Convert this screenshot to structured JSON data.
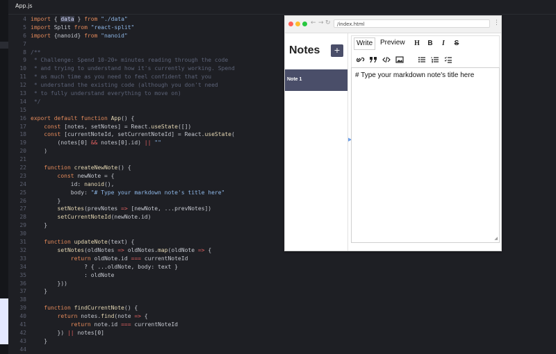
{
  "editor": {
    "file_tab": "App.js",
    "lines": [
      {
        "n": "4",
        "html": "<span class='kw2'>import</span> { <span class='hl'>data</span> } <span class='kw2'>from</span> <span class='str'>\"./data\"</span>"
      },
      {
        "n": "5",
        "html": "<span class='kw2'>import</span> Split <span class='kw2'>from</span> <span class='str'>\"react-split\"</span>"
      },
      {
        "n": "6",
        "html": "<span class='kw2'>import</span> {nanoid} <span class='kw2'>from</span> <span class='str'>\"nanoid\"</span>"
      },
      {
        "n": "7",
        "html": ""
      },
      {
        "n": "8",
        "html": "<span class='cm'>/**</span>"
      },
      {
        "n": "9",
        "html": "<span class='cm'> * Challenge: Spend 10-20+ minutes reading through the code</span>"
      },
      {
        "n": "10",
        "html": "<span class='cm'> * and trying to understand how it's currently working. Spend</span>"
      },
      {
        "n": "11",
        "html": "<span class='cm'> * as much time as you need to feel confident that you</span>"
      },
      {
        "n": "12",
        "html": "<span class='cm'> * understand the existing code (although you don't need</span>"
      },
      {
        "n": "13",
        "html": "<span class='cm'> * to fully understand everything to move on)</span>"
      },
      {
        "n": "14",
        "html": "<span class='cm'> */</span>"
      },
      {
        "n": "15",
        "html": ""
      },
      {
        "n": "16",
        "html": "<span class='kw2'>export default function</span> <span class='fn'>App</span>() {"
      },
      {
        "n": "17",
        "html": "    <span class='kw2'>const</span> [notes, setNotes] = React.<span class='fn'>useState</span>([])"
      },
      {
        "n": "18",
        "html": "    <span class='kw2'>const</span> [currentNoteId, setCurrentNoteId] = React.<span class='fn'>useState</span>("
      },
      {
        "n": "19",
        "html": "        (notes[0] <span class='op'>&amp;&amp;</span> notes[0].id) <span class='op'>||</span> <span class='str'>\"\"</span>"
      },
      {
        "n": "20",
        "html": "    )"
      },
      {
        "n": "21",
        "html": ""
      },
      {
        "n": "22",
        "html": "    <span class='kw2'>function</span> <span class='fn'>createNewNote</span>() {"
      },
      {
        "n": "23",
        "html": "        <span class='kw2'>const</span> newNote = {"
      },
      {
        "n": "24",
        "html": "            id: <span class='fn'>nanoid</span>(),"
      },
      {
        "n": "25",
        "html": "            body: <span class='str'>\"# Type your markdown note's title here\"</span>"
      },
      {
        "n": "26",
        "html": "        }"
      },
      {
        "n": "27",
        "html": "        <span class='fn'>setNotes</span>(prevNotes <span class='op'>=&gt;</span> [newNote, ...prevNotes])"
      },
      {
        "n": "28",
        "html": "        <span class='fn'>setCurrentNoteId</span>(newNote.id)"
      },
      {
        "n": "29",
        "html": "    }"
      },
      {
        "n": "30",
        "html": ""
      },
      {
        "n": "31",
        "html": "    <span class='kw2'>function</span> <span class='fn'>updateNote</span>(text) {"
      },
      {
        "n": "32",
        "html": "        <span class='fn'>setNotes</span>(oldNotes <span class='op'>=&gt;</span> oldNotes.<span class='fn'>map</span>(oldNote <span class='op'>=&gt;</span> {"
      },
      {
        "n": "33",
        "html": "            <span class='kw2'>return</span> oldNote.id <span class='op'>===</span> currentNoteId"
      },
      {
        "n": "34",
        "html": "                ? { ...oldNote, body: text }"
      },
      {
        "n": "35",
        "html": "                : oldNote"
      },
      {
        "n": "36",
        "html": "        }))"
      },
      {
        "n": "37",
        "html": "    }"
      },
      {
        "n": "38",
        "html": ""
      },
      {
        "n": "39",
        "html": "    <span class='kw2'>function</span> <span class='fn'>findCurrentNote</span>() {"
      },
      {
        "n": "40",
        "html": "        <span class='kw2'>return</span> notes.<span class='fn'>find</span>(note <span class='op'>=&gt;</span> {"
      },
      {
        "n": "41",
        "html": "            <span class='kw2'>return</span> note.id <span class='op'>===</span> currentNoteId"
      },
      {
        "n": "42",
        "html": "        }) <span class='op'>||</span> notes[0]"
      },
      {
        "n": "43",
        "html": "    }"
      },
      {
        "n": "44",
        "html": ""
      }
    ]
  },
  "browser": {
    "nav_back": "←",
    "nav_forward": "→",
    "nav_reload": "↻",
    "url": "/index.html",
    "menu": "⋮"
  },
  "app": {
    "sidebar_title": "Notes",
    "add_button": "+",
    "notes": [
      {
        "label": "Note 1"
      }
    ],
    "tabs": {
      "write": "Write",
      "preview": "Preview"
    },
    "toolbar_row1": [
      "H",
      "B",
      "I",
      "S"
    ],
    "toolbar_row2": [
      "link-icon",
      "quote-icon",
      "code-icon",
      "image-icon",
      "unordered-list-icon",
      "ordered-list-icon",
      "checklist-icon"
    ],
    "textarea_value": "# Type your markdown note's title here"
  },
  "colors": {
    "accent": "#4a4e69",
    "editor_bg": "#1e1f24"
  }
}
